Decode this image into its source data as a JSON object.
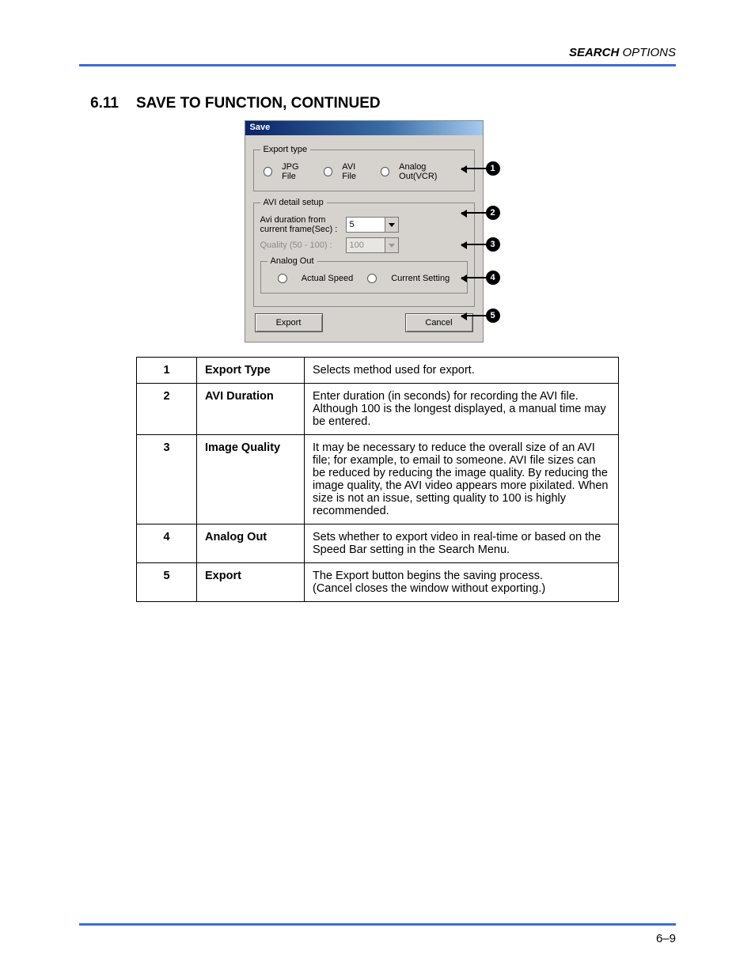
{
  "header": {
    "bold": "SEARCH",
    "rest": " OPTIONS"
  },
  "section": {
    "number": "6.11",
    "title": "SAVE TO FUNCTION, CONTINUED"
  },
  "dialog": {
    "title": "Save",
    "export_type": {
      "legend": "Export type",
      "options": [
        "JPG File",
        "AVI File",
        "Analog Out(VCR)"
      ]
    },
    "avi_detail": {
      "legend": "AVI detail setup",
      "duration_label": "Avi duration from current frame(Sec) :",
      "duration_value": "5",
      "quality_label": "Quality (50 - 100) :",
      "quality_value": "100"
    },
    "analog_out": {
      "legend": "Analog Out",
      "options": [
        "Actual Speed",
        "Current Setting"
      ]
    },
    "buttons": {
      "export": "Export",
      "cancel": "Cancel"
    }
  },
  "callouts": [
    "1",
    "2",
    "3",
    "4",
    "5"
  ],
  "table": [
    {
      "n": "1",
      "name": "Export Type",
      "desc": "Selects method used for export."
    },
    {
      "n": "2",
      "name": "AVI Duration",
      "desc": "Enter duration (in seconds) for recording the AVI file. Although 100 is the longest displayed, a manual time may be entered."
    },
    {
      "n": "3",
      "name": "Image Quality",
      "desc": "It may be necessary to reduce the overall size of an AVI file; for example, to email to someone. AVI file sizes can be reduced by reducing the image quality. By reducing the image quality, the AVI video appears more pixilated. When size is not an issue, setting quality to 100 is highly recommended."
    },
    {
      "n": "4",
      "name": "Analog Out",
      "desc": "Sets whether to export video in real-time or based on the Speed Bar setting in the Search Menu."
    },
    {
      "n": "5",
      "name": "Export",
      "desc": "The Export button begins the saving process.\n(Cancel closes the window without exporting.)"
    }
  ],
  "page_number": "6–9"
}
